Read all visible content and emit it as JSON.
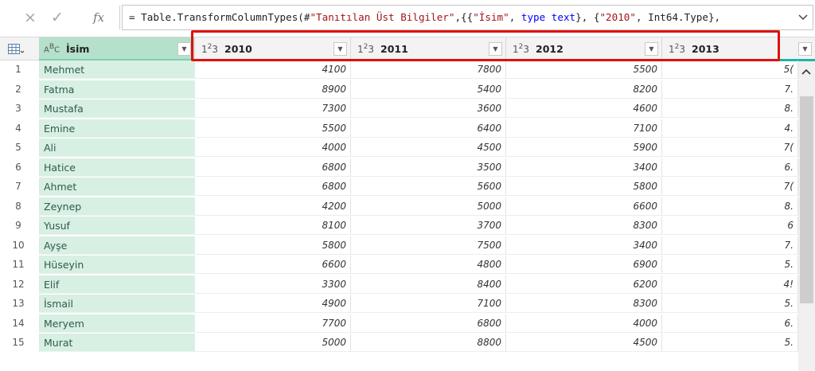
{
  "formula": {
    "cancel_icon": "×",
    "commit_icon": "✓",
    "fx_label": "fx",
    "p1": "= Table.TransformColumnTypes(#",
    "s1": "\"Tanıtılan Üst Bilgiler\"",
    "p2": ",{{",
    "s2": "\"İsim\"",
    "p3": ", ",
    "k1": "type text",
    "p4": "}, {",
    "s3": "\"2010\"",
    "p5": ", Int64.Type},"
  },
  "columns": [
    {
      "type": "ABC",
      "name": "İsim"
    },
    {
      "type": "123",
      "name": "2010"
    },
    {
      "type": "123",
      "name": "2011"
    },
    {
      "type": "123",
      "name": "2012"
    },
    {
      "type": "123",
      "name": "2013"
    }
  ],
  "rows": [
    {
      "n": "1",
      "name": "Mehmet",
      "v": [
        "4100",
        "7800",
        "5500",
        "5("
      ]
    },
    {
      "n": "2",
      "name": "Fatma",
      "v": [
        "8900",
        "5400",
        "8200",
        "7."
      ]
    },
    {
      "n": "3",
      "name": "Mustafa",
      "v": [
        "7300",
        "3600",
        "4600",
        "8."
      ]
    },
    {
      "n": "4",
      "name": "Emine",
      "v": [
        "5500",
        "6400",
        "7100",
        "4."
      ]
    },
    {
      "n": "5",
      "name": "Ali",
      "v": [
        "4000",
        "4500",
        "5900",
        "7("
      ]
    },
    {
      "n": "6",
      "name": "Hatice",
      "v": [
        "6800",
        "3500",
        "3400",
        "6."
      ]
    },
    {
      "n": "7",
      "name": "Ahmet",
      "v": [
        "6800",
        "5600",
        "5800",
        "7("
      ]
    },
    {
      "n": "8",
      "name": "Zeynep",
      "v": [
        "4200",
        "5000",
        "6600",
        "8."
      ]
    },
    {
      "n": "9",
      "name": "Yusuf",
      "v": [
        "8100",
        "3700",
        "8300",
        "6"
      ]
    },
    {
      "n": "10",
      "name": "Ayşe",
      "v": [
        "5800",
        "7500",
        "3400",
        "7."
      ]
    },
    {
      "n": "11",
      "name": "Hüseyin",
      "v": [
        "6600",
        "4800",
        "6900",
        "5."
      ]
    },
    {
      "n": "12",
      "name": "Elif",
      "v": [
        "3300",
        "8400",
        "6200",
        "4!"
      ]
    },
    {
      "n": "13",
      "name": "İsmail",
      "v": [
        "4900",
        "7100",
        "8300",
        "5."
      ]
    },
    {
      "n": "14",
      "name": "Meryem",
      "v": [
        "7700",
        "6800",
        "4000",
        "6."
      ]
    },
    {
      "n": "15",
      "name": "Murat",
      "v": [
        "5000",
        "8800",
        "4500",
        "5."
      ]
    }
  ],
  "colors": {
    "highlight": "#e01010",
    "name_column": "#d8efe4",
    "teal_bar": "#1fb5a8"
  }
}
